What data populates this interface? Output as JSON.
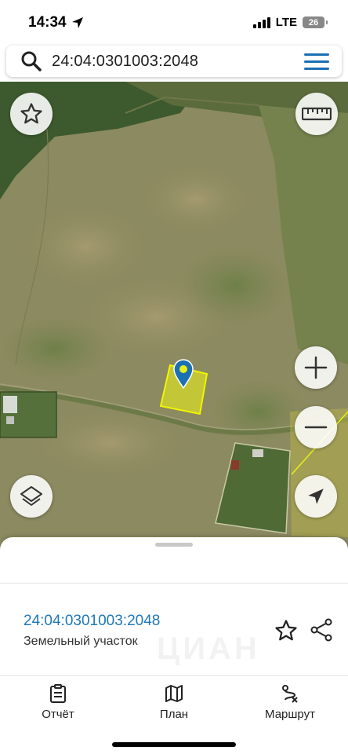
{
  "status_bar": {
    "time": "14:34",
    "network": "LTE",
    "battery": "26"
  },
  "search": {
    "query": "24:04:0301003:2048"
  },
  "map": {
    "controls": [
      "star-icon",
      "ruler-icon",
      "plus-icon",
      "minus-icon",
      "layers-icon",
      "location-arrow-icon"
    ],
    "parcel_color": "#e8ee1a",
    "pin_color": "#1b6fb3"
  },
  "sheet": {
    "parcel_number": "24:04:0301003:2048",
    "parcel_type": "Земельный участок"
  },
  "tabs": [
    {
      "label": "Отчёт",
      "icon": "report-icon"
    },
    {
      "label": "План",
      "icon": "map-icon"
    },
    {
      "label": "Маршрут",
      "icon": "route-icon"
    }
  ],
  "colors": {
    "accent": "#1b6fb3",
    "link": "#1f77b9"
  }
}
